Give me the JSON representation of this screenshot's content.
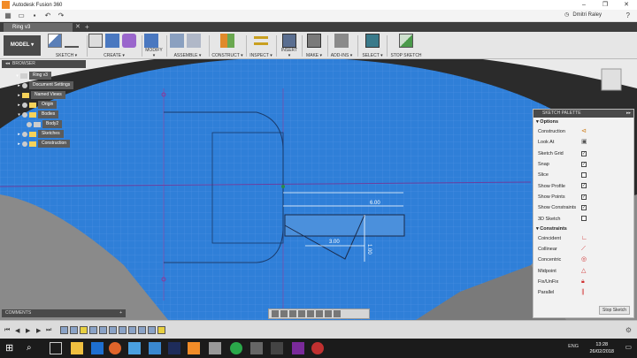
{
  "window": {
    "title": "Autodesk Fusion 360",
    "controls": [
      "–",
      "❐",
      "✕"
    ]
  },
  "quickaccess": {
    "user": "Dmitri Raley",
    "help": "?"
  },
  "tab": {
    "label": "Ring v3",
    "close": "✕",
    "new": "+"
  },
  "toolbar": {
    "mode": "MODEL ▾",
    "groups": {
      "sketch": "SKETCH ▾",
      "create": "CREATE ▾",
      "modify": "MODIFY ▾",
      "assemble": "ASSEMBLE ▾",
      "construct": "CONSTRUCT ▾",
      "inspect": "INSPECT ▾",
      "insert": "INSERT ▾",
      "make": "MAKE ▾",
      "addins": "ADD-INS ▾",
      "select": "SELECT ▾",
      "stop": "STOP SKETCH"
    }
  },
  "browser": {
    "title": "BROWSER",
    "nodes": {
      "root": "Ring v3",
      "docsettings": "Document Settings",
      "namedviews": "Named Views",
      "origin": "Origin",
      "bodies": "Bodies",
      "body2": "Body2",
      "sketches": "Sketches",
      "construction": "Construction"
    }
  },
  "comments": {
    "label": "COMMENTS",
    "add": "+"
  },
  "sketch_dims": {
    "d1": "6.00",
    "d2": "3.00",
    "d3": "1.00"
  },
  "palette": {
    "title": "SKETCH PALETTE",
    "options_label": "Options",
    "options": {
      "construction": "Construction",
      "lookat": "Look At",
      "grid": "Sketch Grid",
      "snap": "Snap",
      "slice": "Slice",
      "showprofile": "Show Profile",
      "showpoints": "Show Points",
      "showconstraints": "Show Constraints",
      "sketch3d": "3D Sketch"
    },
    "constraints_label": "Constraints",
    "constraints": {
      "coincident": "Coincident",
      "collinear": "Collinear",
      "concentric": "Concentric",
      "midpoint": "Midpoint",
      "fixunfix": "Fix/UnFix",
      "parallel": "Parallel"
    },
    "stop": "Stop Sketch"
  },
  "taskbar": {
    "lang": "ENG",
    "time": "13:28",
    "date": "26/02/2018"
  },
  "colors": {
    "canvas_blue": "#2f7fd8",
    "toolbar": "#e6e6e6",
    "panel_dark": "#4a4a4a"
  }
}
